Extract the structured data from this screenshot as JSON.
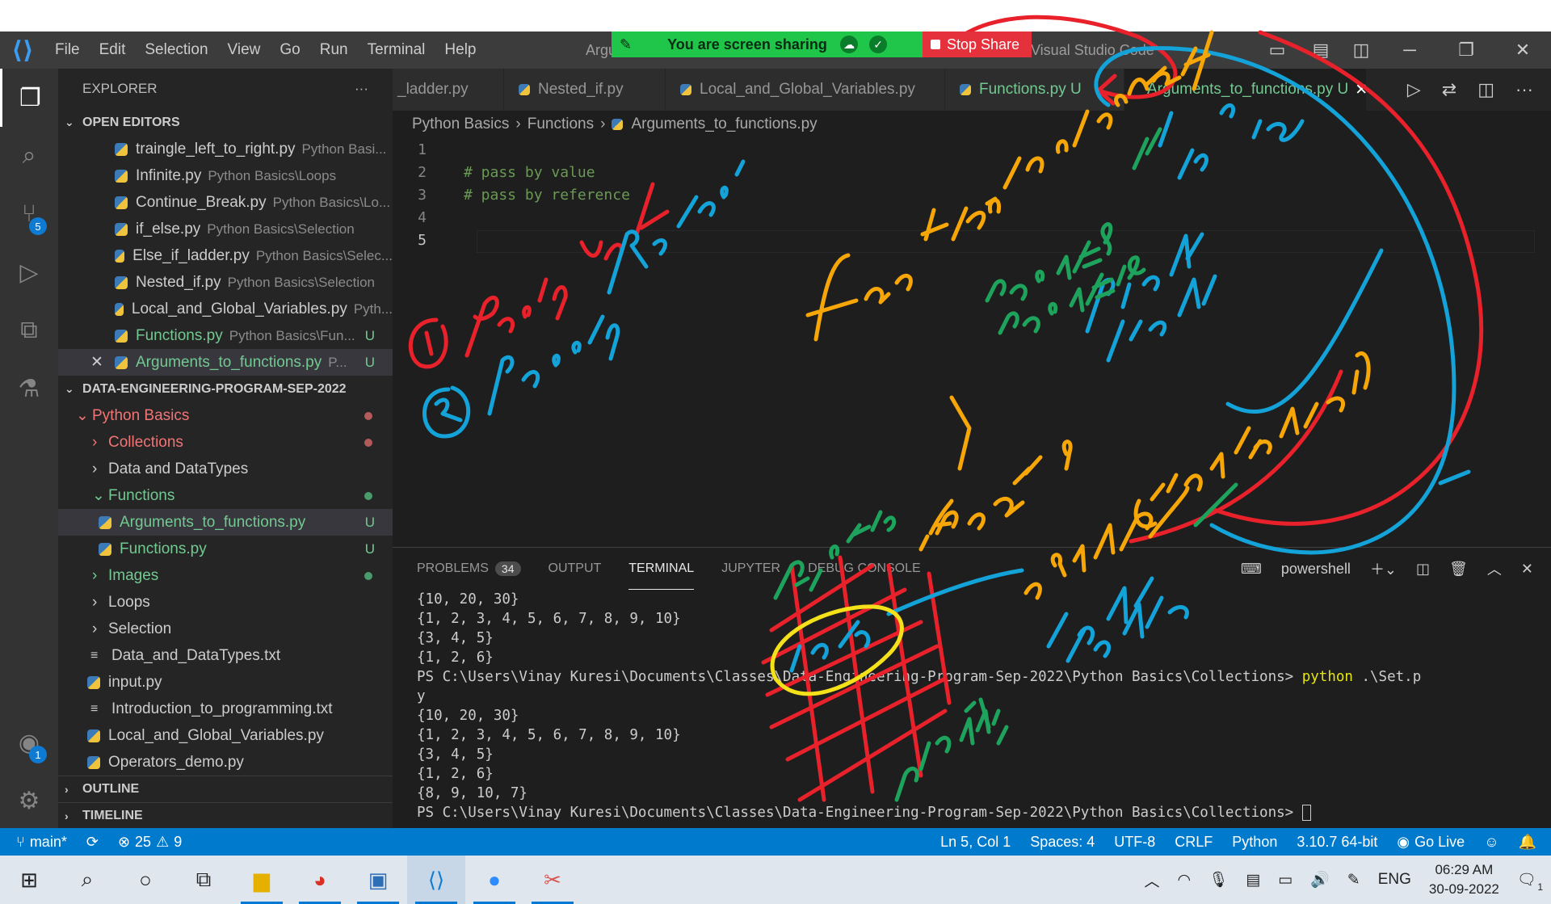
{
  "share_banner": {
    "message": "You are screen sharing",
    "stop_label": "Stop Share"
  },
  "titlebar": {
    "menu": [
      "File",
      "Edit",
      "Selection",
      "View",
      "Go",
      "Run",
      "Terminal",
      "Help"
    ],
    "title_left": "Argu",
    "title_right": "Visual Studio Code"
  },
  "activity_badges": {
    "source_control": "5",
    "accounts": "1"
  },
  "sidebar": {
    "header": "EXPLORER",
    "open_editors_title": "OPEN EDITORS",
    "open_editors": [
      {
        "name": "traingle_left_to_right.py",
        "path": "Python Basi..."
      },
      {
        "name": "Infinite.py",
        "path": "Python Basics\\Loops"
      },
      {
        "name": "Continue_Break.py",
        "path": "Python Basics\\Lo..."
      },
      {
        "name": "if_else.py",
        "path": "Python Basics\\Selection"
      },
      {
        "name": "Else_if_ladder.py",
        "path": "Python Basics\\Selec..."
      },
      {
        "name": "Nested_if.py",
        "path": "Python Basics\\Selection"
      },
      {
        "name": "Local_and_Global_Variables.py",
        "path": "Pyth..."
      },
      {
        "name": "Functions.py",
        "path": "Python Basics\\Fun...",
        "status": "U"
      },
      {
        "name": "Arguments_to_functions.py",
        "path": "P...",
        "status": "U",
        "close": "✕"
      }
    ],
    "project_title": "DATA-ENGINEERING-PROGRAM-SEP-2022",
    "tree": {
      "python_basics": "Python Basics",
      "collections": "Collections",
      "data_types": "Data and DataTypes",
      "functions": "Functions",
      "args_file": "Arguments_to_functions.py",
      "args_status": "U",
      "functions_file": "Functions.py",
      "functions_status": "U",
      "images": "Images",
      "loops": "Loops",
      "selection": "Selection",
      "data_txt": "Data_and_DataTypes.txt",
      "input_py": "input.py",
      "intro_txt": "Introduction_to_programming.txt",
      "local_global": "Local_and_Global_Variables.py",
      "operators": "Operators_demo.py"
    },
    "outline": "OUTLINE",
    "timeline": "TIMELINE"
  },
  "tabs": [
    {
      "label": "_ladder.py"
    },
    {
      "label": "Nested_if.py"
    },
    {
      "label": "Local_and_Global_Variables.py"
    },
    {
      "label": "Functions.py",
      "status": "U"
    },
    {
      "label": "Arguments_to_functions.py",
      "status": "U"
    }
  ],
  "breadcrumb": {
    "folder1": "Python Basics",
    "folder2": "Functions",
    "file": "Arguments_to_functions.py"
  },
  "editor_lines": [
    {
      "n": "1",
      "text": ""
    },
    {
      "n": "2",
      "text": "# pass by value"
    },
    {
      "n": "3",
      "text": "# pass by reference"
    },
    {
      "n": "4",
      "text": ""
    },
    {
      "n": "5",
      "text": ""
    }
  ],
  "panel": {
    "tabs": [
      "PROBLEMS",
      "OUTPUT",
      "TERMINAL",
      "JUPYTER",
      "DEBUG CONSOLE"
    ],
    "problems_count": "34",
    "shell": "powershell",
    "terminal_lines": [
      "{10, 20, 30}",
      "{1, 2, 3, 4, 5, 6, 7, 8, 9, 10}",
      "{3, 4, 5}",
      "{1, 2, 6}",
      "PS C:\\Users\\Vinay Kuresi\\Documents\\Classes\\Data-Engineering-Program-Sep-2022\\Python Basics\\Collections> ",
      "y",
      "{10, 20, 30}",
      "{1, 2, 3, 4, 5, 6, 7, 8, 9, 10}",
      "{3, 4, 5}",
      "{1, 2, 6}",
      "{8, 9, 10, 7}",
      "PS C:\\Users\\Vinay Kuresi\\Documents\\Classes\\Data-Engineering-Program-Sep-2022\\Python Basics\\Collections> "
    ],
    "terminal_cmd": "python",
    "terminal_cmd_arg": " .\\Set.p"
  },
  "statusbar": {
    "branch": "main*",
    "errors": "25",
    "warnings": "9",
    "position": "Ln 5, Col 1",
    "spaces": "Spaces: 4",
    "encoding": "UTF-8",
    "eol": "CRLF",
    "language": "Python",
    "interpreter": "3.10.7 64-bit",
    "golive": "Go Live"
  },
  "taskbar": {
    "lang": "ENG",
    "time": "06:29 AM",
    "date": "30-09-2022",
    "notifications": "1"
  },
  "colors": {
    "accent": "#007acc",
    "modified": "#73c991",
    "error": "#f27474",
    "ink_red": "#e8212b",
    "ink_blue": "#13a3d9",
    "ink_orange": "#f7a608",
    "ink_green": "#1ea35d",
    "ink_yellow": "#f5e11a"
  },
  "ink_annotations": [
    "① pass by value",
    "② pass by Reference",
    "function name ( num1 , num2 )",
    "num1 = 8",
    "num2 = 10",
    "num1 = 1",
    "num2 = 7",
    "name ( num1 , num2 )",
    "num1 → 8",
    "num2 → 10",
    "Actual",
    "formal"
  ]
}
